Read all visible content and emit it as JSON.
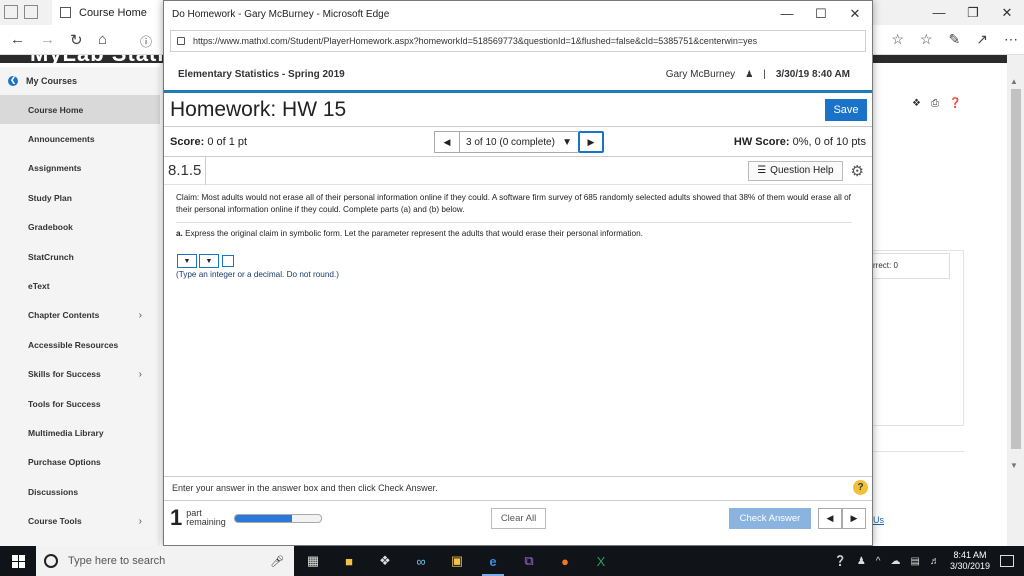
{
  "back_window": {
    "tab_title": "Course Home",
    "banner_text": "MyLab Statistics",
    "sidebar": {
      "header": "My Courses",
      "items": [
        {
          "label": "Course Home",
          "active": true,
          "chevron": false
        },
        {
          "label": "Announcements",
          "chevron": false
        },
        {
          "label": "Assignments",
          "chevron": false
        },
        {
          "label": "Study Plan",
          "chevron": false
        },
        {
          "label": "Gradebook",
          "chevron": false
        },
        {
          "label": "StatCrunch",
          "chevron": false
        },
        {
          "label": "eText",
          "chevron": false
        },
        {
          "label": "Chapter Contents",
          "chevron": true
        },
        {
          "label": "Accessible Resources",
          "chevron": false
        },
        {
          "label": "Skills for Success",
          "chevron": true
        },
        {
          "label": "Tools for Success",
          "chevron": false
        },
        {
          "label": "Multimedia Library",
          "chevron": false
        },
        {
          "label": "Purchase Options",
          "chevron": false
        },
        {
          "label": "Discussions",
          "chevron": false
        },
        {
          "label": "Course Tools",
          "chevron": true
        }
      ]
    },
    "right_partial_text": "rrect: 0",
    "bottom_link": "Us"
  },
  "popup": {
    "window_title": "Do Homework - Gary McBurney - Microsoft Edge",
    "url": "https://www.mathxl.com/Student/PlayerHomework.aspx?homeworkId=518569773&questionId=1&flushed=false&cId=5385751&centerwin=yes",
    "course_name": "Elementary Statistics - Spring 2019",
    "user_name": "Gary McBurney",
    "separator": "|",
    "datetime": "3/30/19 8:40 AM",
    "hw_title": "Homework: HW 15",
    "save_label": "Save",
    "score_label": "Score:",
    "score_value": "0 of 1 pt",
    "question_nav": "3 of 10 (0 complete)",
    "hw_score_label": "HW Score:",
    "hw_score_value": "0%, 0 of 10 pts",
    "question_id": "8.1.5",
    "question_help_label": "Question Help",
    "claim_text": "Claim: Most adults would not erase all of their personal information online if they could. A software firm survey of 685 randomly selected adults showed that 38% of them would erase all of their personal information online if they could. Complete parts (a) and (b) below.",
    "part_a_label": "a.",
    "part_a_text": "Express the original claim in symbolic form. Let the parameter represent the adults that would erase their personal information.",
    "answer_hint": "(Type an integer or a decimal. Do not round.)",
    "footer_instruction": "Enter your answer in the answer box and then click Check Answer.",
    "parts_count": "1",
    "parts_label_line1": "part",
    "parts_label_line2": "remaining",
    "progress_fraction": 0.67,
    "clear_all_label": "Clear All",
    "check_answer_label": "Check Answer"
  },
  "taskbar": {
    "search_placeholder": "Type here to search",
    "time": "8:41 AM",
    "date": "3/30/2019"
  },
  "colors": {
    "accent_blue": "#1a73c8",
    "check_button": "#8bb3df",
    "help_yellow": "#f2c037",
    "taskbar": "#101318"
  }
}
